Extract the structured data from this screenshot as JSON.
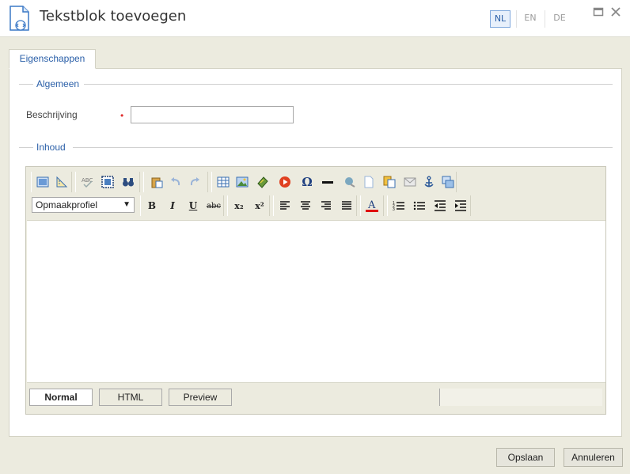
{
  "dialog": {
    "title": "Tekstblok toevoegen",
    "icon": "document-code-icon",
    "languages": [
      {
        "code": "NL",
        "active": true
      },
      {
        "code": "EN",
        "active": false
      },
      {
        "code": "DE",
        "active": false
      }
    ]
  },
  "tabs": [
    {
      "label": "Eigenschappen",
      "active": true
    }
  ],
  "sections": {
    "general": {
      "legend": "Algemeen",
      "description_label": "Beschrijving",
      "required_marker": "•",
      "description_value": ""
    },
    "content": {
      "legend": "Inhoud"
    }
  },
  "editor": {
    "style_select": {
      "value": "Opmaakprofiel"
    },
    "toolbar_row1": [
      "fullscreen-icon",
      "ruler-icon",
      "spellcheck-icon",
      "select-all-icon",
      "find-icon",
      "paste-icon",
      "undo-icon",
      "redo-icon",
      "table-icon",
      "image-icon",
      "media-icon",
      "video-icon",
      "special-char-icon",
      "horizontal-rule-icon",
      "link-icon",
      "new-document-icon",
      "copy-format-icon",
      "mail-icon",
      "anchor-icon",
      "template-icon"
    ],
    "toolbar_row2": {
      "bold": "B",
      "italic": "I",
      "underline": "U",
      "strike": "abc",
      "subscript": "x₂",
      "superscript": "x²",
      "font_color": "A"
    },
    "modes": [
      {
        "label": "Normal",
        "active": true
      },
      {
        "label": "HTML",
        "active": false
      },
      {
        "label": "Preview",
        "active": false
      }
    ],
    "content": ""
  },
  "footer": {
    "save_label": "Opslaan",
    "cancel_label": "Annuleren"
  },
  "colors": {
    "accent": "#2a5fa8",
    "required": "#e03030",
    "background": "#ecebdf"
  }
}
